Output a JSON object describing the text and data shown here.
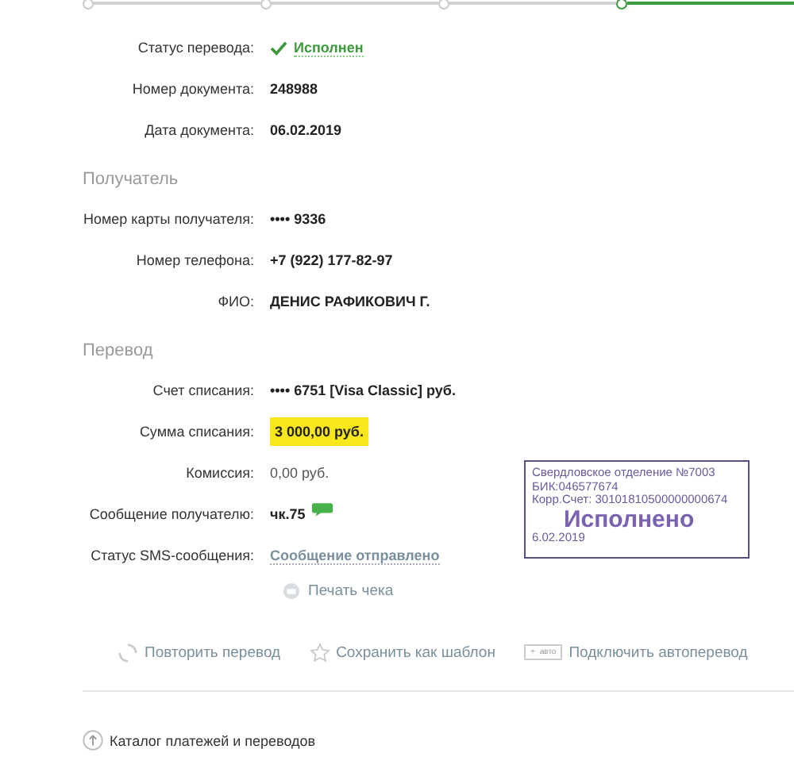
{
  "steps": [
    {
      "active": false
    },
    {
      "active": false
    },
    {
      "active": false
    },
    {
      "active": true
    }
  ],
  "sections": [
    {
      "rows": [
        {
          "label": "Статус перевода:",
          "value": "Исполнен",
          "kind": "status"
        },
        {
          "label": "Номер документа:",
          "value": "248988",
          "kind": "bold"
        },
        {
          "label": "Дата документа:",
          "value": "06.02.2019",
          "kind": "bold"
        }
      ]
    },
    {
      "title": "Получатель",
      "rows": [
        {
          "label": "Номер карты получателя:",
          "value": "•••• 9336",
          "kind": "bold"
        },
        {
          "label": "Номер телефона:",
          "value": "+7 (922) 177-82-97",
          "kind": "bold"
        },
        {
          "label": "ФИО:",
          "value": "ДЕНИС РАФИКОВИЧ Г.",
          "kind": "bold"
        }
      ]
    },
    {
      "title": "Перевод",
      "rows": [
        {
          "label": "Счет списания:",
          "value": "•••• 6751  [Visa Classic]  руб.",
          "kind": "bold"
        },
        {
          "label": "Сумма списания:",
          "value": "3 000,00  руб.",
          "kind": "highlight"
        },
        {
          "label": "Комиссия:",
          "value": "0,00 руб.",
          "kind": "plain"
        },
        {
          "label": "Сообщение получателю:",
          "value": "чк.75",
          "kind": "sms"
        },
        {
          "label": "Статус SMS-сообщения:",
          "value": "Сообщение отправлено",
          "kind": "link"
        }
      ]
    }
  ],
  "stamp": {
    "lines": [
      "Свердловское отделение №7003",
      "БИК:046577674",
      "Корр.Счет: 30101810500000000674"
    ],
    "title": "Исполнено",
    "date": "6.02.2019"
  },
  "print": "Печать чека",
  "actions": [
    {
      "label": "Повторить перевод",
      "kind": "repeat"
    },
    {
      "label": "Сохранить как шаблон",
      "kind": "star"
    },
    {
      "label": "Подключить автоперевод",
      "kind": "auto",
      "badge_sign": "+",
      "badge": "авто"
    }
  ],
  "catalog": "Каталог платежей и переводов"
}
